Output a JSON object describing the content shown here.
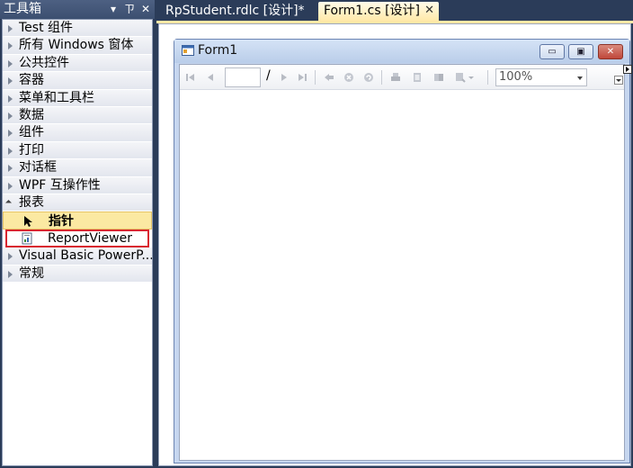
{
  "toolbox": {
    "title": "工具箱",
    "header_buttons": [
      "▾",
      "ㄗ",
      "✕"
    ],
    "categories": [
      {
        "label": "Test 组件"
      },
      {
        "label": "所有 Windows 窗体"
      },
      {
        "label": "公共控件"
      },
      {
        "label": "容器"
      },
      {
        "label": "菜单和工具栏"
      },
      {
        "label": "数据"
      },
      {
        "label": "组件"
      },
      {
        "label": "打印"
      },
      {
        "label": "对话框"
      },
      {
        "label": "WPF 互操作性"
      },
      {
        "label": "报表",
        "open": true
      }
    ],
    "report_items": [
      {
        "label": "指针",
        "icon": "pointer-icon",
        "selected": true
      },
      {
        "label": "ReportViewer",
        "icon": "report-viewer-icon",
        "highlighted": true
      }
    ],
    "categories_after": [
      {
        "label": "Visual Basic PowerP..."
      },
      {
        "label": "常规"
      }
    ]
  },
  "tabs": [
    {
      "label": "RpStudent.rdlc [设计]*",
      "active": false
    },
    {
      "label": "Form1.cs [设计]",
      "active": true,
      "close": "✕"
    }
  ],
  "form": {
    "title": "Form1",
    "window_buttons": {
      "minimize": "▭",
      "maximize": "▣",
      "close": "✕"
    },
    "report_toolbar": {
      "page_input": "",
      "page_separator": "/",
      "zoom": "100%"
    }
  },
  "colors": {
    "ide_background": "#2b3c59",
    "active_tab": "#ffe8a6",
    "highlight_box": "#d9262f",
    "selected_item": "#fbe9a2"
  }
}
